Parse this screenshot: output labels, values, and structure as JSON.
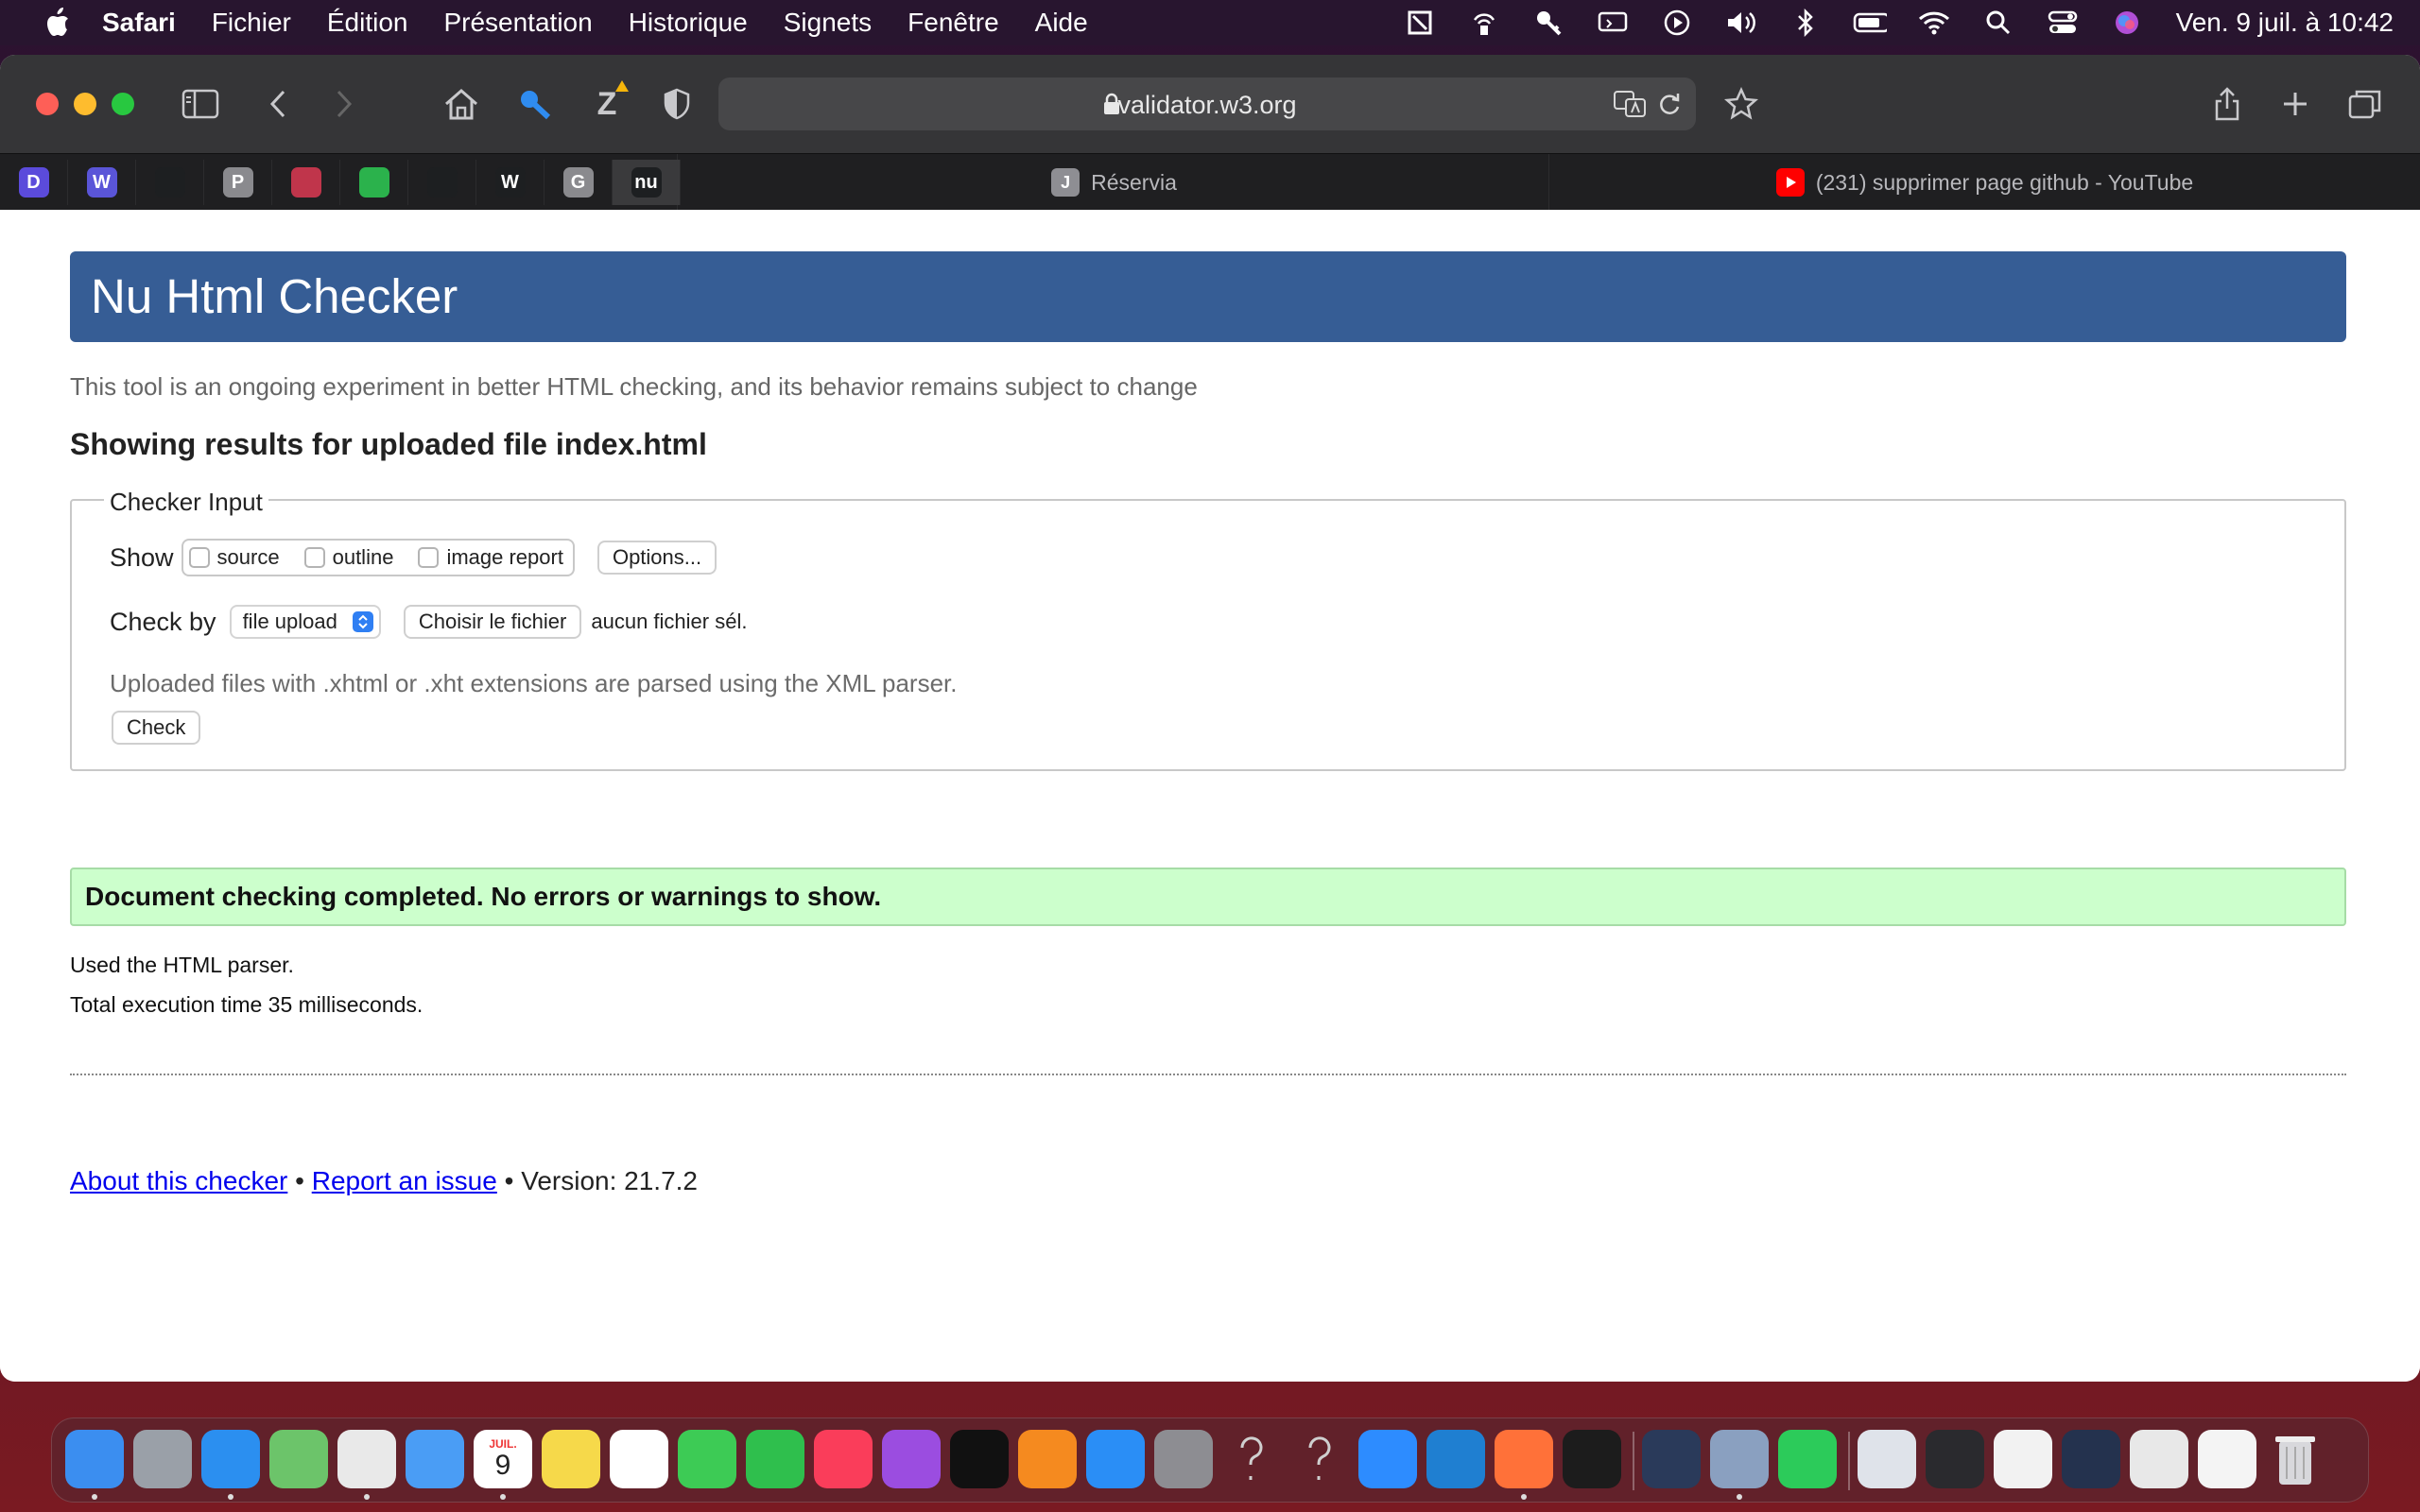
{
  "menubar": {
    "items": [
      "Safari",
      "Fichier",
      "Édition",
      "Présentation",
      "Historique",
      "Signets",
      "Fenêtre",
      "Aide"
    ],
    "clock": "Ven. 9 juil. à  10:42"
  },
  "browser": {
    "url": "validator.w3.org",
    "reader_badge": "Z",
    "pinned_tabs": [
      {
        "icon": "dash-icon",
        "letter": "D",
        "color": "#5b4bdb"
      },
      {
        "icon": "wordpress-icon",
        "letter": "W",
        "color": "#5a55d8"
      },
      {
        "icon": "twitter-icon",
        "letter": "",
        "color": "#1d1f21"
      },
      {
        "icon": "p-icon",
        "letter": "P",
        "color": "#8a8a8e"
      },
      {
        "icon": "creature-icon",
        "letter": "",
        "color": "#c0354b"
      },
      {
        "icon": "feedly-icon",
        "letter": "",
        "color": "#2bb24c"
      },
      {
        "icon": "github-icon",
        "letter": "",
        "color": "#1d1f21"
      },
      {
        "icon": "w3-icon",
        "letter": "W",
        "color": "#1d1f21"
      },
      {
        "icon": "g-icon",
        "letter": "G",
        "color": "#8a8a8e"
      },
      {
        "icon": "nu-icon",
        "letter": "nu",
        "color": "#1d1f21"
      }
    ],
    "tabs": [
      {
        "title": "Réservia",
        "fav_letter": "J"
      },
      {
        "title": "(231) supprimer page github - YouTube",
        "fav_letter": ""
      }
    ]
  },
  "page": {
    "banner_title": "Nu Html Checker",
    "subtitle": "This tool is an ongoing experiment in better HTML checking, and its behavior remains subject to change",
    "results_heading": "Showing results for uploaded file index.html",
    "fieldset_legend": "Checker Input",
    "show_label": "Show",
    "checkboxes": [
      "source",
      "outline",
      "image report"
    ],
    "options_button": "Options...",
    "checkby_label": "Check by",
    "checkby_value": "file upload",
    "choose_file_button": "Choisir le fichier",
    "no_file_text": "aucun fichier sél.",
    "hint": "Uploaded files with .xhtml or .xht extensions are parsed using the XML parser.",
    "check_button": "Check",
    "success_message": "Document checking completed. No errors or warnings to show.",
    "parser_info": "Used the HTML parser.",
    "execution_info": "Total execution time 35 milliseconds.",
    "footer": {
      "about_link": "About this checker",
      "separator": "•",
      "report_link": "Report an issue",
      "version": "Version: 21.7.2"
    }
  },
  "dock": {
    "calendar_month": "JUIL.",
    "calendar_day": "9",
    "apps": [
      {
        "name": "finder-icon",
        "color": "#3b8ef0"
      },
      {
        "name": "launchpad-icon",
        "color": "#9aa0a8"
      },
      {
        "name": "safari-icon",
        "color": "#2b8ff0"
      },
      {
        "name": "maps-icon",
        "color": "#6cc46a"
      },
      {
        "name": "chrome-icon",
        "color": "#e9e9e9"
      },
      {
        "name": "mail-icon",
        "color": "#4a9df5"
      },
      {
        "name": "calendar-icon",
        "color": "#ffffff"
      },
      {
        "name": "notes-icon",
        "color": "#f6d94a"
      },
      {
        "name": "reminders-icon",
        "color": "#ffffff"
      },
      {
        "name": "messages-icon",
        "color": "#3dcb55"
      },
      {
        "name": "facetime-icon",
        "color": "#2fbf4d"
      },
      {
        "name": "music-icon",
        "color": "#fa3d5a"
      },
      {
        "name": "podcasts-icon",
        "color": "#9b4de0"
      },
      {
        "name": "appletv-icon",
        "color": "#111111"
      },
      {
        "name": "books-icon",
        "color": "#f58a1f"
      },
      {
        "name": "appstore-icon",
        "color": "#2a8ef6"
      },
      {
        "name": "system-preferences-icon",
        "color": "#8d8d92"
      },
      {
        "name": "unknown-app-icon",
        "color": "transparent"
      },
      {
        "name": "unknown-app-icon",
        "color": "transparent"
      },
      {
        "name": "zoom-icon",
        "color": "#2d8cff"
      },
      {
        "name": "vscode-icon",
        "color": "#1f7fd1"
      },
      {
        "name": "firefox-icon",
        "color": "#ff7139"
      },
      {
        "name": "terminal-icon",
        "color": "#1c1c1c"
      },
      {
        "name": "quicktime-icon",
        "color": "#2a3a5a"
      },
      {
        "name": "preview-icon",
        "color": "#8aa0c0"
      },
      {
        "name": "whatsapp-icon",
        "color": "#2ccb5a"
      },
      {
        "name": "window-thumb-icon",
        "color": "#dfe3ea"
      },
      {
        "name": "window-thumb-icon",
        "color": "#2a2a2e"
      },
      {
        "name": "window-thumb-icon",
        "color": "#f2f2f2"
      },
      {
        "name": "window-thumb-icon",
        "color": "#24324e"
      },
      {
        "name": "window-thumb-icon",
        "color": "#e8e8e8"
      },
      {
        "name": "window-thumb-icon",
        "color": "#f4f4f4"
      },
      {
        "name": "trash-icon",
        "color": "#c8c8cc"
      }
    ]
  }
}
